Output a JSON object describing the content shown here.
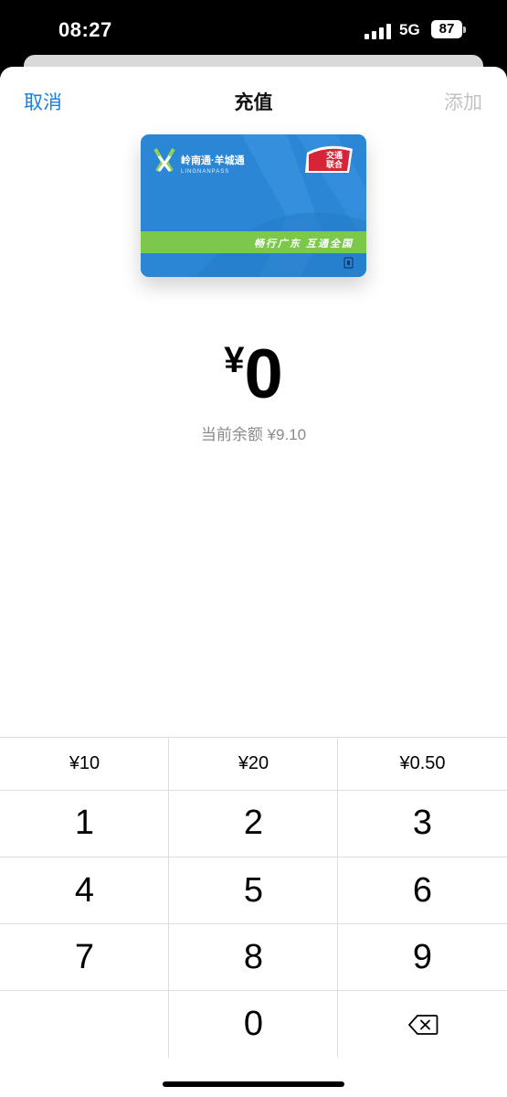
{
  "status": {
    "time": "08:27",
    "network": "5G",
    "battery": "87"
  },
  "nav": {
    "cancel": "取消",
    "title": "充值",
    "add": "添加"
  },
  "card": {
    "name": "岭南通·羊城通",
    "subname": "LINGNANPASS",
    "slogan": "畅行广东 互通全国",
    "badge_line1": "交通",
    "badge_line2": "联合",
    "colors": {
      "card_blue": "#2b86d6",
      "stripe_green": "#7cc84a",
      "badge_red": "#d6243a"
    }
  },
  "amount": {
    "currency": "¥",
    "value": "0"
  },
  "balance": "当前余额 ¥9.10",
  "quick_amounts": [
    "¥10",
    "¥20",
    "¥0.50"
  ],
  "keys": [
    "1",
    "2",
    "3",
    "4",
    "5",
    "6",
    "7",
    "8",
    "9",
    "",
    "0"
  ],
  "icons": {
    "backspace": "backspace-icon",
    "signal": "cellular-signal-icon"
  }
}
